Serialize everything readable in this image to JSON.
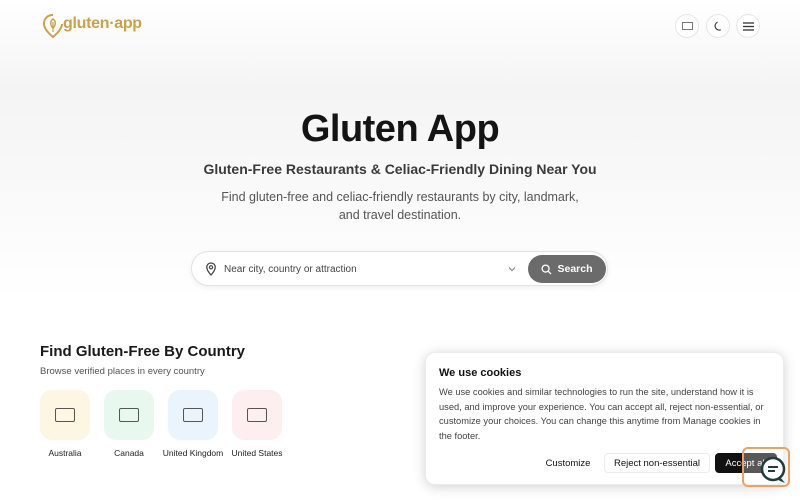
{
  "header": {
    "logo_text": "gluten·app",
    "lang_icon": "flag-icon",
    "theme_icon": "moon-icon",
    "menu_icon": "hamburger-menu-icon"
  },
  "hero": {
    "title": "Gluten App",
    "subtitle": "Gluten-Free Restaurants & Celiac-Friendly Dining Near You",
    "description": "Find gluten-free and celiac-friendly restaurants by city, landmark, and travel destination."
  },
  "search": {
    "placeholder": "Near city, country or attraction",
    "button_label": "Search"
  },
  "countries_section": {
    "title": "Find Gluten-Free By Country",
    "subtitle": "Browse verified places in every country",
    "items": [
      {
        "label": "Australia",
        "bg": "#fdf6e3"
      },
      {
        "label": "Canada",
        "bg": "#e8f8ef"
      },
      {
        "label": "United Kingdom",
        "bg": "#eaf4fc"
      },
      {
        "label": "United States",
        "bg": "#fdeef0"
      }
    ]
  },
  "cookie_banner": {
    "title": "We use cookies",
    "body": "We use cookies and similar technologies to run the site, understand how it is used, and improve your experience. You can accept all, reject non-essential, or customize your choices. You can change this anytime from Manage cookies in the footer.",
    "customize_label": "Customize",
    "reject_label": "Reject non-essential",
    "accept_label": "Accept all"
  },
  "colors": {
    "brand_gold": "#c9a24a",
    "search_button": "#6b6b6b",
    "accept_button": "#111111"
  }
}
